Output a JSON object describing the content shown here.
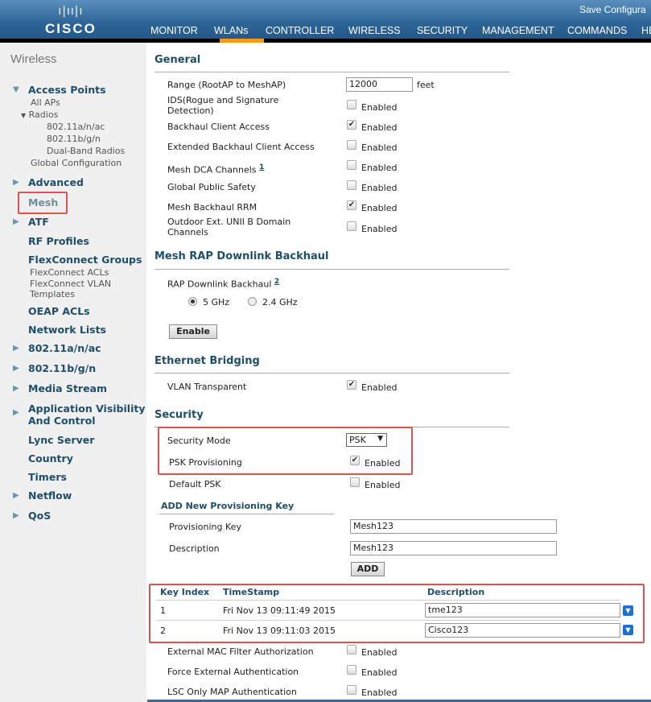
{
  "header": {
    "logo": "CISCO",
    "save": "Save Configura",
    "nav": [
      "MONITOR",
      "WLANs",
      "CONTROLLER",
      "WIRELESS",
      "SECURITY",
      "MANAGEMENT",
      "COMMANDS",
      "HE"
    ],
    "active": "WIRELESS",
    "accent": "#f39c12"
  },
  "sidebar": {
    "title": "Wireless",
    "access_points": "Access Points",
    "all_aps": "All APs",
    "radios": "Radios",
    "r1": "802.11a/n/ac",
    "r2": "802.11b/g/n",
    "r3": "Dual-Band Radios",
    "global": "Global Configuration",
    "advanced": "Advanced",
    "mesh": "Mesh",
    "atf": "ATF",
    "rf": "RF Profiles",
    "flex": "FlexConnect Groups",
    "flex_acl": "FlexConnect ACLs",
    "flex_vlan": "FlexConnect VLAN",
    "templates": "Templates",
    "oeap": "OEAP ACLs",
    "netlists": "Network Lists",
    "a": "802.11a/n/ac",
    "b": "802.11b/g/n",
    "media": "Media Stream",
    "avc1": "Application Visibility",
    "avc2": "And Control",
    "lync": "Lync Server",
    "country": "Country",
    "timers": "Timers",
    "netflow": "Netflow",
    "qos": "QoS"
  },
  "general": {
    "title": "General",
    "range_label": "Range (RootAP to MeshAP)",
    "range_value": "12000",
    "range_unit": "feet",
    "enabled": "Enabled",
    "rows": [
      {
        "label": "IDS(Rogue and Signature",
        "label2": "Detection)",
        "checked": false
      },
      {
        "label": "Backhaul Client Access",
        "checked": true
      },
      {
        "label": "Extended Backhaul Client Access",
        "checked": false
      },
      {
        "label": "Mesh DCA Channels",
        "sup": "1",
        "checked": false
      },
      {
        "label": "Global Public Safety",
        "checked": false
      },
      {
        "label": "Mesh Backhaul RRM",
        "checked": true
      },
      {
        "label": "Outdoor Ext. UNII B Domain",
        "label2": "Channels",
        "checked": false
      }
    ]
  },
  "rap": {
    "title": "Mesh RAP Downlink Backhaul",
    "label": "RAP Downlink Backhaul",
    "sup": "2",
    "opt1": "5 GHz",
    "opt2": "2.4 GHz",
    "selected": "5 GHz",
    "button": "Enable"
  },
  "eth": {
    "title": "Ethernet Bridging",
    "vlan": "VLAN Transparent",
    "checked": true
  },
  "security": {
    "title": "Security",
    "mode_label": "Security Mode",
    "mode_value": "PSK",
    "psk_label": "PSK Provisioning",
    "psk_checked": true,
    "default_label": "Default PSK",
    "default_checked": false,
    "add_title": "ADD New Provisioning Key",
    "key_label": "Provisioning Key",
    "key_value": "Mesh123",
    "desc_label": "Description",
    "desc_value": "Mesh123",
    "add_button": "ADD"
  },
  "table": {
    "headers": [
      "Key Index",
      "TimeStamp",
      "Description"
    ],
    "rows": [
      {
        "index": "1",
        "ts": "Fri Nov 13 09:11:49 2015",
        "desc": "tme123"
      },
      {
        "index": "2",
        "ts": "Fri Nov 13 09:11:03 2015",
        "desc": "Cisco123"
      }
    ]
  },
  "auth": [
    {
      "label": "External MAC Filter Authorization",
      "checked": false
    },
    {
      "label": "Force External Authentication",
      "checked": false
    },
    {
      "label": "LSC Only MAP Authentication",
      "checked": false
    }
  ]
}
